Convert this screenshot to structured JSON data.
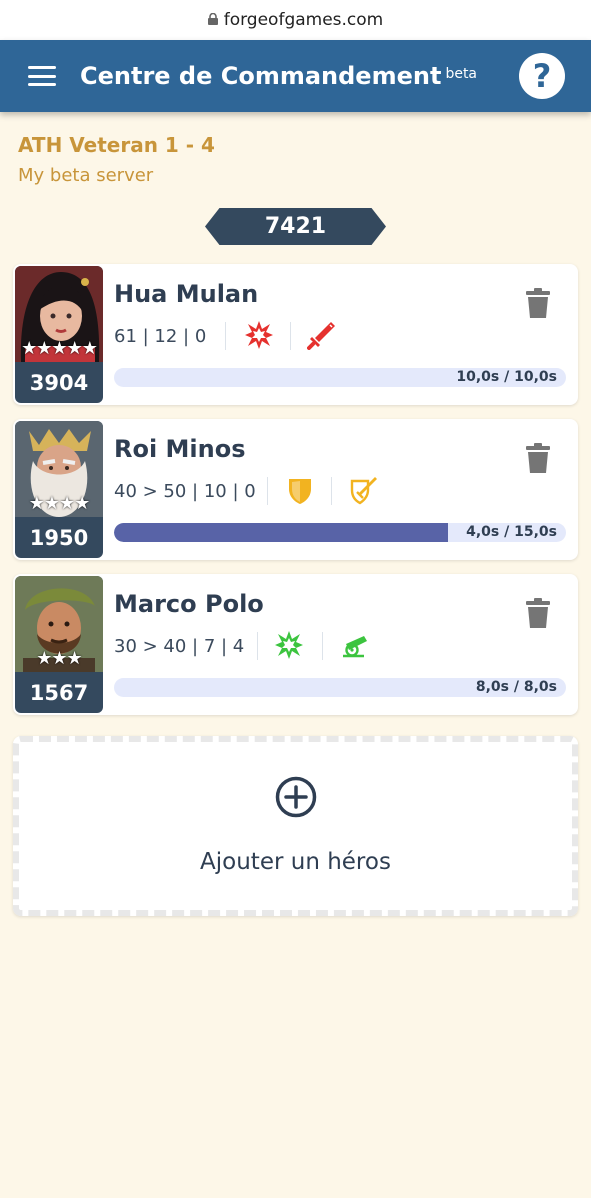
{
  "browser": {
    "url": "forgeofgames.com"
  },
  "header": {
    "title": "Centre de Commandement",
    "badge": "beta",
    "help_label": "?"
  },
  "server": {
    "name": "ATH Veteran 1 - 4",
    "subtitle": "My beta server"
  },
  "total_power": "7421",
  "heroes": [
    {
      "name": "Hua Mulan",
      "stats": "61 | 12 | 0",
      "stars": "★★★★★",
      "power": "3904",
      "skills": [
        "explosion-icon",
        "sword-icon"
      ],
      "skill_colors": [
        "#e5312e",
        "#e5312e"
      ],
      "progress_label": "10,0s / 10,0s",
      "progress_fraction": 0.0
    },
    {
      "name": "Roi Minos",
      "stats": "40 > 50 | 10 | 0",
      "stars": "★★★★",
      "power": "1950",
      "skills": [
        "shield-icon",
        "shield-sword-icon"
      ],
      "skill_colors": [
        "#f2b320",
        "#f2b320"
      ],
      "progress_label": "4,0s / 15,0s",
      "progress_fraction": 0.74
    },
    {
      "name": "Marco Polo",
      "stats": "30 > 40 | 7 | 4",
      "stars": "★★★",
      "power": "1567",
      "skills": [
        "explosion-icon",
        "cannon-icon"
      ],
      "skill_colors": [
        "#3cc43f",
        "#3cc43f"
      ],
      "progress_label": "8,0s / 8,0s",
      "progress_fraction": 0.0
    }
  ],
  "add_hero": {
    "label": "Ajouter un héros"
  },
  "colors": {
    "header": "#2f6697",
    "accent_gold": "#c8953a",
    "dark": "#34495e",
    "progress": "#5863a7",
    "background": "#fdf7e8"
  }
}
